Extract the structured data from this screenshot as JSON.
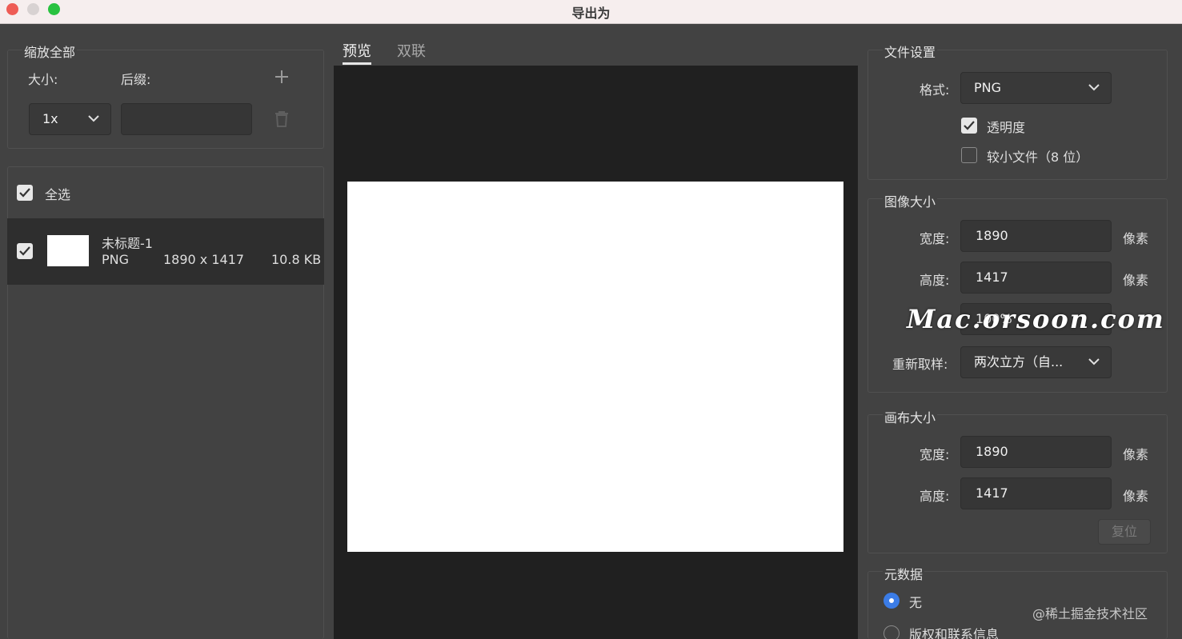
{
  "window": {
    "title": "导出为"
  },
  "scale_group": {
    "title": "缩放全部",
    "size_label": "大小:",
    "suffix_label": "后缀:",
    "size_value": "1x",
    "suffix_value": "",
    "add_icon": "plus-icon",
    "delete_icon": "trash-icon"
  },
  "asset_list": {
    "select_all_label": "全选",
    "select_all_checked": true,
    "items": [
      {
        "name": "未标题-1",
        "format": "PNG",
        "dimensions": "1890 x 1417",
        "size": "10.8 KB",
        "checked": true
      }
    ]
  },
  "preview": {
    "tabs": [
      {
        "label": "预览",
        "active": true
      },
      {
        "label": "双联",
        "active": false
      }
    ]
  },
  "file_settings": {
    "title": "文件设置",
    "format_label": "格式:",
    "format_value": "PNG",
    "transparency_label": "透明度",
    "transparency_checked": true,
    "smaller_file_label": "较小文件（8 位）",
    "smaller_file_checked": false
  },
  "image_size": {
    "title": "图像大小",
    "width_label": "宽度:",
    "width_value": "1890",
    "height_label": "高度:",
    "height_value": "1417",
    "scale_value": "100%",
    "unit": "像素",
    "resample_label": "重新取样:",
    "resample_value": "两次立方（自..."
  },
  "canvas_size": {
    "title": "画布大小",
    "width_label": "宽度:",
    "width_value": "1890",
    "height_label": "高度:",
    "height_value": "1417",
    "unit": "像素",
    "reset_label": "复位"
  },
  "metadata": {
    "title": "元数据",
    "options": [
      {
        "label": "无",
        "selected": true
      },
      {
        "label": "版权和联系信息",
        "selected": false
      }
    ]
  },
  "watermarks": {
    "overlay": "Mac.orsoon.com",
    "footer": "@稀土掘金技术社区"
  },
  "colors": {
    "accent": "#3b7ce6",
    "panel": "#424242",
    "preview_bg": "#202020"
  }
}
